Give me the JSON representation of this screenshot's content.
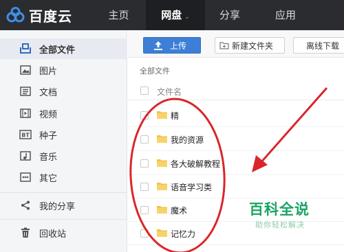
{
  "app": {
    "logo_text": "百度云",
    "brand_color": "#3d7fd6"
  },
  "nav": {
    "items": [
      {
        "label": "主页",
        "icon": ""
      },
      {
        "label": "网盘",
        "icon": "chevron-down-icon",
        "active": true
      },
      {
        "label": "分享",
        "icon": ""
      },
      {
        "label": "应用",
        "icon": ""
      }
    ]
  },
  "sidebar": {
    "items": [
      {
        "label": "全部文件",
        "icon": "all-files-icon",
        "active": true
      },
      {
        "label": "图片",
        "icon": "image-icon"
      },
      {
        "label": "文档",
        "icon": "document-icon"
      },
      {
        "label": "视频",
        "icon": "video-icon"
      },
      {
        "label": "种子",
        "icon": "torrent-icon"
      },
      {
        "label": "音乐",
        "icon": "music-icon"
      },
      {
        "label": "其它",
        "icon": "more-icon"
      },
      {
        "label": "我的分享",
        "icon": "share-icon"
      },
      {
        "label": "回收站",
        "icon": "trash-icon"
      }
    ]
  },
  "toolbar": {
    "upload_label": "上传",
    "new_folder_label": "新建文件夹",
    "offline_label": "离线下载"
  },
  "breadcrumb": "全部文件",
  "file_list": {
    "header_name": "文件名",
    "rows": [
      {
        "name": "精",
        "icon": "folder-icon"
      },
      {
        "name": "我的资源",
        "icon": "folder-icon"
      },
      {
        "name": "各大破解教程",
        "icon": "folder-icon"
      },
      {
        "name": "语音学习类",
        "icon": "folder-icon"
      },
      {
        "name": "魔术",
        "icon": "folder-icon"
      },
      {
        "name": "记忆力",
        "icon": "folder-icon"
      }
    ]
  },
  "watermark": {
    "title": "百科全说",
    "subtitle": "助你轻松解决",
    "color": "#1aa364"
  },
  "annotation": {
    "color": "#d9262a"
  }
}
